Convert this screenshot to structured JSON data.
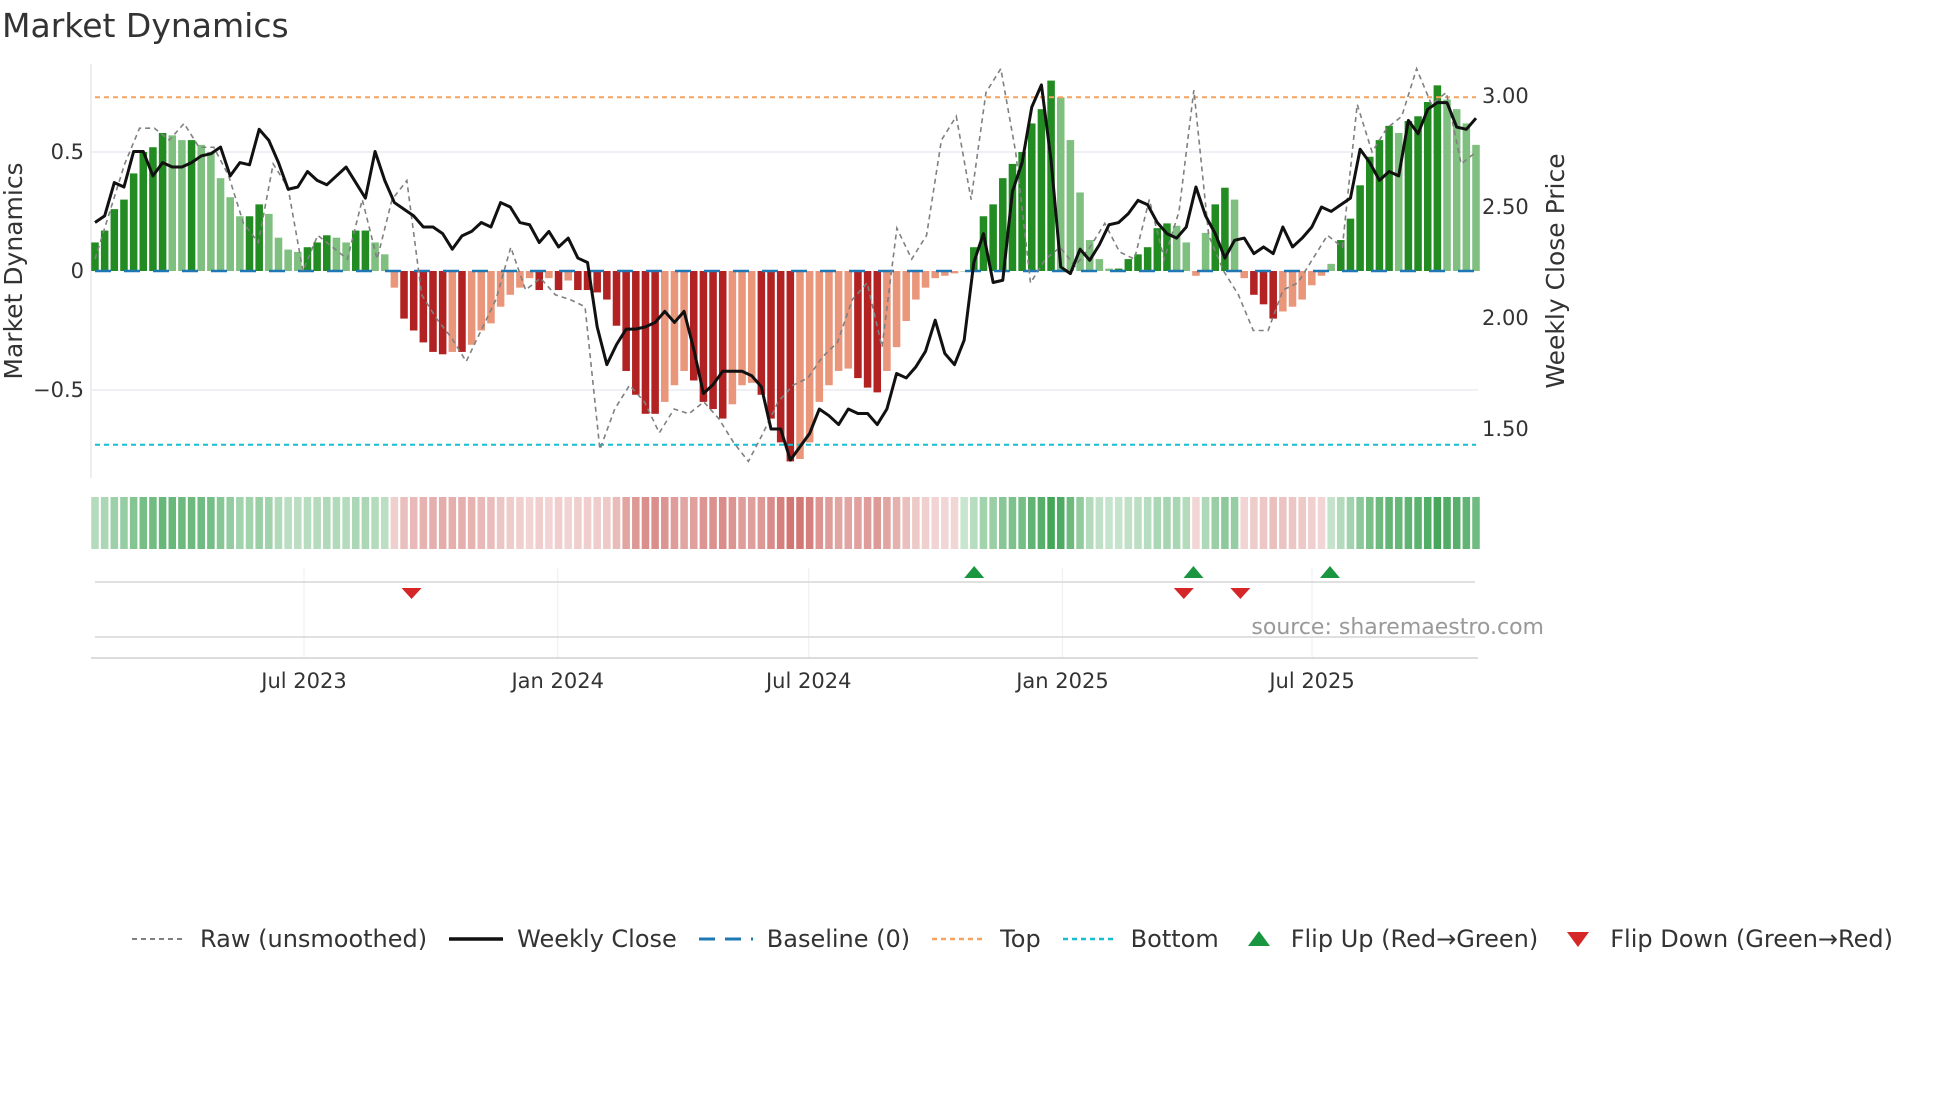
{
  "title": "Market Dynamics",
  "source": "source: sharemaestro.com",
  "chart_data": {
    "type": "bar",
    "title": "Market Dynamics",
    "ylabel": "Market Dynamics",
    "y2label": "Weekly Close Price",
    "ylim": [
      -0.88,
      0.87
    ],
    "y2lim": [
      1.25,
      3.3
    ],
    "yticks": [
      {
        "v": 0.5,
        "label": "0.5"
      },
      {
        "v": 0,
        "label": "0"
      },
      {
        "v": -0.5,
        "label": "−0.5"
      }
    ],
    "y2ticks": [
      {
        "v": 3.0,
        "label": "3.00"
      },
      {
        "v": 2.5,
        "label": "2.50"
      },
      {
        "v": 2.0,
        "label": "2.00"
      },
      {
        "v": 1.5,
        "label": "1.50"
      }
    ],
    "xticks": [
      {
        "date": "2023-07-01",
        "label": "Jul 2023"
      },
      {
        "date": "2024-01-01",
        "label": "Jan 2024"
      },
      {
        "date": "2024-07-01",
        "label": "Jul 2024"
      },
      {
        "date": "2025-01-01",
        "label": "Jan 2025"
      },
      {
        "date": "2025-07-01",
        "label": "Jul 2025"
      }
    ],
    "start_date": "2023-01-30",
    "end_date": "2025-10-18",
    "top": 0.73,
    "bottom": -0.73,
    "baseline": 0,
    "market_dynamics": [
      0.12,
      0.17,
      0.26,
      0.3,
      0.41,
      0.5,
      0.52,
      0.58,
      0.57,
      0.55,
      0.55,
      0.53,
      0.5,
      0.39,
      0.31,
      0.23,
      0.23,
      0.28,
      0.24,
      0.14,
      0.09,
      0.08,
      0.1,
      0.12,
      0.15,
      0.14,
      0.12,
      0.17,
      0.17,
      0.12,
      0.07,
      -0.07,
      -0.2,
      -0.25,
      -0.3,
      -0.34,
      -0.35,
      -0.34,
      -0.34,
      -0.31,
      -0.25,
      -0.22,
      -0.15,
      -0.1,
      -0.07,
      -0.03,
      -0.08,
      -0.03,
      -0.08,
      -0.04,
      -0.08,
      -0.08,
      -0.09,
      -0.12,
      -0.23,
      -0.42,
      -0.52,
      -0.6,
      -0.6,
      -0.55,
      -0.48,
      -0.42,
      -0.46,
      -0.55,
      -0.58,
      -0.62,
      -0.56,
      -0.48,
      -0.47,
      -0.52,
      -0.62,
      -0.72,
      -0.8,
      -0.79,
      -0.72,
      -0.55,
      -0.48,
      -0.42,
      -0.41,
      -0.45,
      -0.49,
      -0.51,
      -0.42,
      -0.32,
      -0.21,
      -0.12,
      -0.07,
      -0.03,
      -0.02,
      -0.01,
      0.0,
      0.1,
      0.23,
      0.28,
      0.39,
      0.45,
      0.5,
      0.62,
      0.68,
      0.8,
      0.73,
      0.55,
      0.33,
      0.13,
      0.05,
      0.01,
      0.01,
      0.05,
      0.07,
      0.1,
      0.18,
      0.2,
      0.19,
      0.12,
      -0.02,
      0.16,
      0.28,
      0.35,
      0.3,
      -0.03,
      -0.1,
      -0.14,
      -0.2,
      -0.17,
      -0.15,
      -0.12,
      -0.06,
      -0.02,
      0.03,
      0.13,
      0.22,
      0.36,
      0.48,
      0.55,
      0.61,
      0.58,
      0.63,
      0.65,
      0.71,
      0.78,
      0.72,
      0.68,
      0.62,
      0.53
    ],
    "raw": [
      0.05,
      0.25,
      0.45,
      0.6,
      0.6,
      0.55,
      0.62,
      0.52,
      0.52,
      0.4,
      0.2,
      0.12,
      0.45,
      0.35,
      0.0,
      0.15,
      0.1,
      0.05,
      0.3,
      0.05,
      0.3,
      0.38,
      -0.1,
      -0.2,
      -0.28,
      -0.38,
      -0.25,
      -0.12,
      0.1,
      -0.08,
      -0.03,
      -0.1,
      -0.12,
      -0.15,
      -0.75,
      -0.58,
      -0.48,
      -0.55,
      -0.68,
      -0.58,
      -0.6,
      -0.55,
      -0.62,
      -0.72,
      -0.8,
      -0.68,
      -0.55,
      -0.48,
      -0.45,
      -0.36,
      -0.3,
      -0.12,
      -0.05,
      -0.32,
      0.18,
      0.05,
      0.15,
      0.55,
      0.65,
      0.3,
      0.75,
      0.85,
      0.5,
      -0.05,
      0.05,
      0.1,
      0.02,
      0.1,
      0.2,
      0.08,
      0.05,
      0.3,
      0.05,
      0.25,
      0.76,
      0.15,
      0.0,
      -0.1,
      -0.25,
      -0.25,
      -0.08,
      -0.05,
      0.05,
      0.15,
      0.1,
      0.7,
      0.5,
      0.6,
      0.65,
      0.85,
      0.7,
      0.75,
      0.45,
      0.5
    ],
    "weekly_close": [
      2.43,
      2.46,
      2.61,
      2.59,
      2.75,
      2.75,
      2.64,
      2.7,
      2.68,
      2.68,
      2.7,
      2.73,
      2.74,
      2.77,
      2.64,
      2.7,
      2.69,
      2.85,
      2.8,
      2.7,
      2.58,
      2.59,
      2.66,
      2.62,
      2.6,
      2.64,
      2.68,
      2.61,
      2.54,
      2.75,
      2.62,
      2.52,
      2.49,
      2.46,
      2.41,
      2.41,
      2.38,
      2.31,
      2.37,
      2.39,
      2.43,
      2.41,
      2.52,
      2.5,
      2.43,
      2.42,
      2.34,
      2.39,
      2.32,
      2.36,
      2.27,
      2.25,
      1.96,
      1.79,
      1.88,
      1.95,
      1.95,
      1.96,
      1.98,
      2.03,
      1.98,
      2.03,
      1.86,
      1.66,
      1.7,
      1.76,
      1.76,
      1.76,
      1.74,
      1.69,
      1.5,
      1.5,
      1.36,
      1.42,
      1.48,
      1.59,
      1.56,
      1.52,
      1.59,
      1.57,
      1.57,
      1.52,
      1.59,
      1.75,
      1.73,
      1.78,
      1.85,
      1.99,
      1.84,
      1.79,
      1.9,
      2.25,
      2.38,
      2.16,
      2.17,
      2.57,
      2.7,
      2.95,
      3.05,
      2.71,
      2.23,
      2.2,
      2.31,
      2.26,
      2.33,
      2.42,
      2.43,
      2.47,
      2.53,
      2.51,
      2.43,
      2.38,
      2.36,
      2.41,
      2.59,
      2.46,
      2.38,
      2.27,
      2.35,
      2.36,
      2.29,
      2.32,
      2.29,
      2.41,
      2.32,
      2.36,
      2.41,
      2.5,
      2.48,
      2.51,
      2.54,
      2.76,
      2.7,
      2.62,
      2.66,
      2.64,
      2.89,
      2.83,
      2.94,
      2.97,
      2.97,
      2.86,
      2.85,
      2.9
    ],
    "flips_up": [
      "2024-10-29",
      "2025-04-06",
      "2025-07-14"
    ],
    "flips_down": [
      "2023-09-17",
      "2025-03-30",
      "2025-05-10"
    ],
    "colors": {
      "green_dark": "#228b22",
      "green_light": "#7fbf7f",
      "red_dark": "#b22222",
      "red_light": "#e9967a",
      "close": "#111111",
      "raw": "#808080",
      "baseline": "#1f77b4",
      "top": "#f4a460",
      "bottom": "#17becf",
      "flip_up": "#1a9641",
      "flip_down": "#d62728"
    },
    "legend_position": "bottom",
    "legend": [
      {
        "key": "raw",
        "label": "Raw (unsmoothed)"
      },
      {
        "key": "close",
        "label": "Weekly Close"
      },
      {
        "key": "baseline",
        "label": "Baseline (0)"
      },
      {
        "key": "top",
        "label": "Top"
      },
      {
        "key": "bottom",
        "label": "Bottom"
      },
      {
        "key": "up",
        "label": "Flip Up (Red→Green)"
      },
      {
        "key": "down",
        "label": "Flip Down (Green→Red)"
      }
    ]
  }
}
